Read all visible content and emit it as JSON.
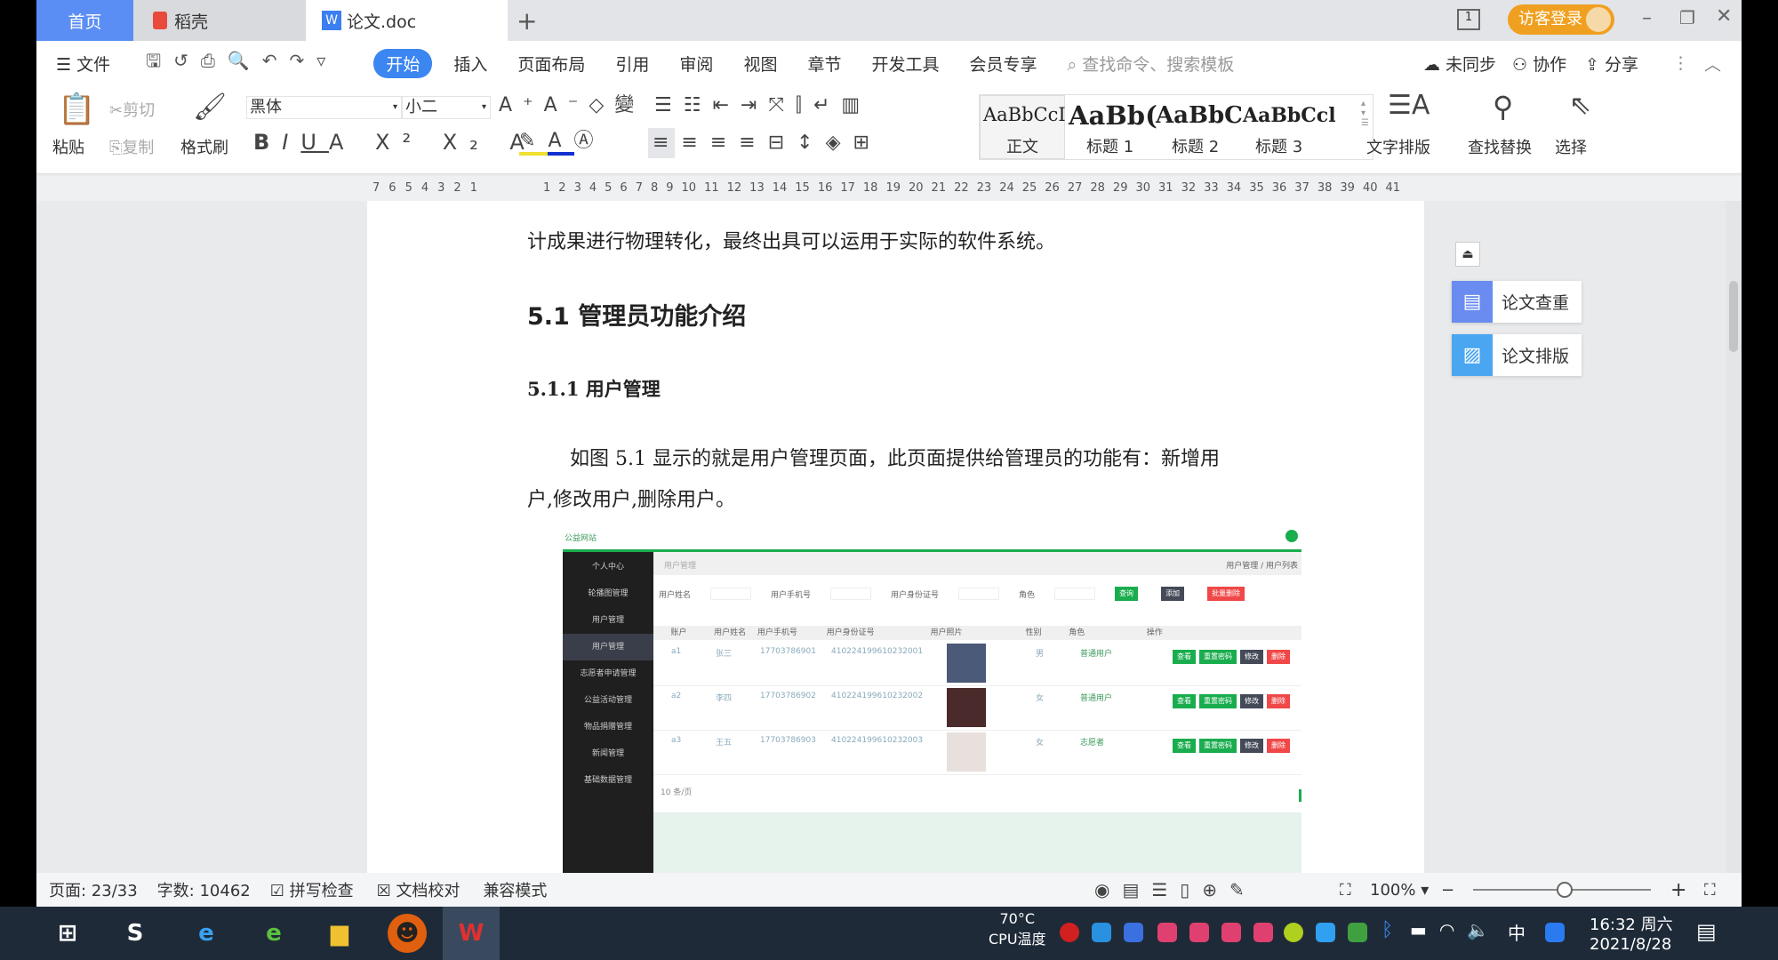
{
  "tabs": [
    {
      "label": "首页"
    },
    {
      "label": "稻壳"
    },
    {
      "label": "论文.doc"
    }
  ],
  "window": {
    "login": "访客登录",
    "new_tab": "+"
  },
  "menu": {
    "file": "文件",
    "items": [
      "开始",
      "插入",
      "页面布局",
      "引用",
      "审阅",
      "视图",
      "章节",
      "开发工具",
      "会员专享"
    ],
    "search_placeholder": "查找命令、搜索模板",
    "sync": "未同步",
    "collab": "协作",
    "share": "分享"
  },
  "ribbon": {
    "paste": "粘贴",
    "cut": "剪切",
    "copy": "复制",
    "format_painter": "格式刷",
    "font": "黑体",
    "size": "小二",
    "styles": [
      {
        "preview": "AaBbCcI",
        "label": "正文"
      },
      {
        "preview": "AaBb(",
        "label": "标题 1"
      },
      {
        "preview": "AaBbC",
        "label": "标题 2"
      },
      {
        "preview": "AaBbCcl",
        "label": "标题 3"
      }
    ],
    "text_layout": "文字排版",
    "find_replace": "查找替换",
    "select": "选择"
  },
  "ruler": {
    "left": [
      "7",
      "6",
      "5",
      "4",
      "3",
      "2",
      "1"
    ],
    "right": [
      "1",
      "2",
      "3",
      "4",
      "5",
      "6",
      "7",
      "8",
      "9",
      "10",
      "11",
      "12",
      "13",
      "14",
      "15",
      "16",
      "17",
      "18",
      "19",
      "20",
      "21",
      "22",
      "23",
      "24",
      "25",
      "26",
      "27",
      "28",
      "29",
      "30",
      "31",
      "32",
      "33",
      "34",
      "35",
      "36",
      "37",
      "38",
      "39",
      "40",
      "41"
    ]
  },
  "doc": {
    "line1": "计成果进行物理转化，最终出具可以运用于实际的软件系统。",
    "h2": "5.1  管理员功能介绍",
    "h3": "5.1.1  用户管理",
    "para1": "如图 5.1 显示的就是用户管理页面，此页面提供给管理员的功能有：新增用",
    "para2": "户,修改用户,删除用户。"
  },
  "figure": {
    "site": "公益网站",
    "sidebar": [
      "个人中心",
      "轮播图管理",
      "用户管理",
      "用户管理",
      "志愿者申请管理",
      "公益活动管理",
      "物品捐赠管理",
      "新闻管理",
      "基础数据管理"
    ],
    "crumb": "用户管理",
    "crumb_right": "用户管理 / 用户列表",
    "filters": [
      "用户姓名",
      "用户手机号",
      "用户身份证号",
      "角色"
    ],
    "actions": [
      "查询",
      "添加",
      "批量删除"
    ],
    "headers": [
      "账户",
      "用户姓名",
      "用户手机号",
      "用户身份证号",
      "用户照片",
      "性别",
      "角色",
      "操作"
    ],
    "rows": [
      {
        "acc": "a1",
        "name": "张三",
        "phone": "17703786901",
        "id": "410224199610232001",
        "sex": "男",
        "role": "普通用户"
      },
      {
        "acc": "a2",
        "name": "李四",
        "phone": "17703786902",
        "id": "410224199610232002",
        "sex": "女",
        "role": "普通用户"
      },
      {
        "acc": "a3",
        "name": "王五",
        "phone": "17703786903",
        "id": "410224199610232003",
        "sex": "女",
        "role": "志愿者"
      }
    ],
    "row_buttons": [
      "查看",
      "重置密码",
      "修改",
      "删除"
    ],
    "pager": "10 条/页"
  },
  "side_panel": {
    "check": "论文查重",
    "layout": "论文排版"
  },
  "status": {
    "page": "页面: 23/33",
    "words": "字数: 10462",
    "spell": "拼写检查",
    "proof": "文档校对",
    "compat": "兼容模式",
    "zoom": "100%"
  },
  "taskbar": {
    "cpu_temp": "70°C",
    "cpu_label": "CPU温度",
    "time": "16:32 周六",
    "date": "2021/8/28",
    "ime": "中"
  },
  "colors": {
    "home_tab": "#5b8ef5",
    "accent": "#3b86f0",
    "login": "#f0a020",
    "green": "#1aad4e",
    "red": "#f04848"
  }
}
